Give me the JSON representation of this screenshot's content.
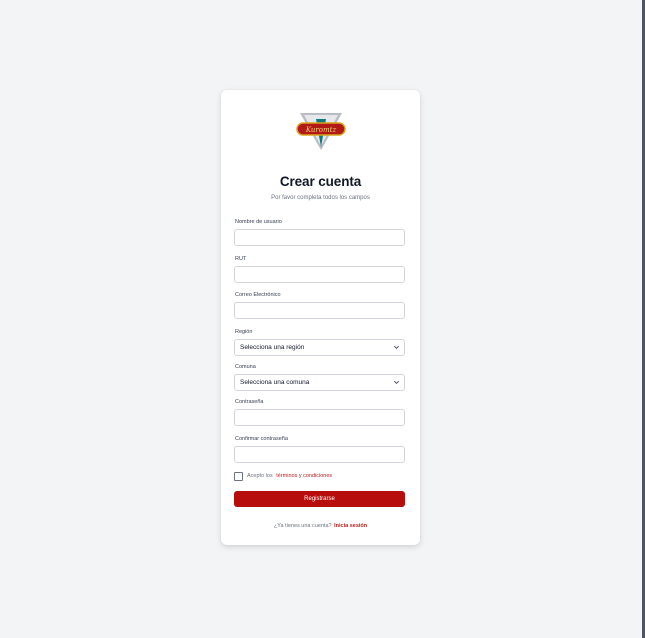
{
  "brand": {
    "logo_text": "Kuromtz",
    "colors": {
      "primary": "#b80d0d",
      "link": "#b91c1c",
      "logo_red": "#b21a16",
      "logo_gold": "#d9a321"
    }
  },
  "form": {
    "title": "Crear cuenta",
    "subtitle": "Por favor completa todos los campos",
    "fields": {
      "username": {
        "label": "Nombre de usuario",
        "value": ""
      },
      "rut": {
        "label": "RUT",
        "value": ""
      },
      "email": {
        "label": "Correo Electrónico",
        "value": ""
      },
      "region": {
        "label": "Región",
        "selected": "Selecciona una región"
      },
      "comuna": {
        "label": "Comuna",
        "selected": "Selecciona una comuna"
      },
      "password": {
        "label": "Contraseña",
        "value": ""
      },
      "confirm_password": {
        "label": "Confirmar contraseña",
        "value": ""
      }
    },
    "terms": {
      "prefix": "Acepto los",
      "link": "términos y condiciones",
      "checked": false
    },
    "submit_label": "Registrarse"
  },
  "footer": {
    "question": "¿Ya tienes una cuenta?",
    "link": "Inicia sesión"
  },
  "icons": {
    "select_chevron": "chevron-down-icon",
    "logo": "brand-logo"
  }
}
